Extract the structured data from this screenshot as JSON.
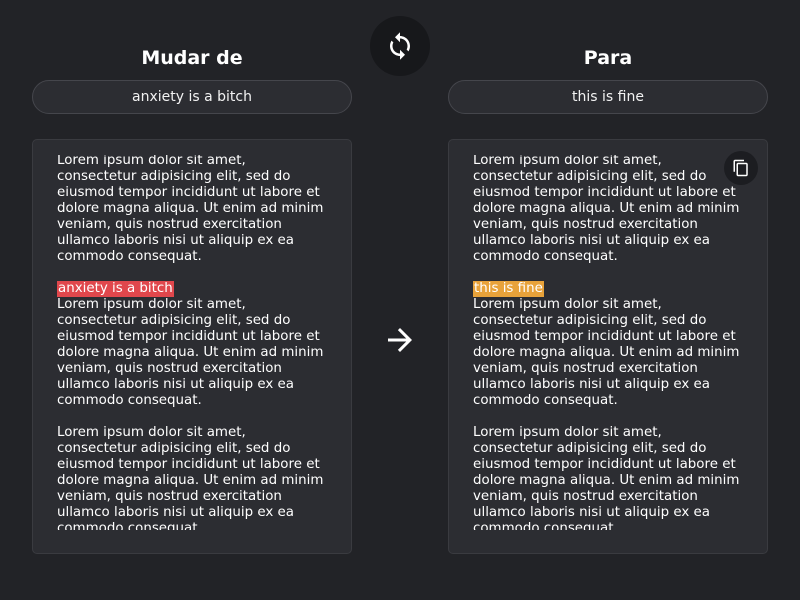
{
  "swap": {
    "icon": "swap-arrows-icon"
  },
  "source": {
    "title": "Mudar de",
    "value": "anxiety is a bitch",
    "paragraphs": [
      "Lorem ipsum dolor sit amet, consectetur adipisicing elit, sed do eiusmod tempor incididunt ut labore et dolore magna aliqua. Ut enim ad minim veniam, quis nostrud exercitation ullamco laboris nisi ut aliquip ex ea commodo consequat.",
      "Lorem ipsum dolor sit amet, consectetur adipisicing elit, sed do eiusmod tempor incididunt ut labore et dolore magna aliqua. Ut enim ad minim veniam, quis nostrud exercitation ullamco laboris nisi ut aliquip ex ea commodo consequat.",
      "Lorem ipsum dolor sit amet, consectetur adipisicing elit, sed do eiusmod tempor incididunt ut labore et dolore magna aliqua. Ut enim ad minim veniam, quis nostrud exercitation ullamco laboris nisi ut aliquip ex ea commodo consequat."
    ],
    "highlight": "anxiety is a bitch",
    "highlight_color": "#e0474c"
  },
  "target": {
    "title": "Para",
    "value": "this is fine",
    "paragraphs": [
      "Lorem ipsum dolor sit amet, consectetur adipisicing elit, sed do eiusmod tempor incididunt ut labore et dolore magna aliqua. Ut enim ad minim veniam, quis nostrud exercitation ullamco laboris nisi ut aliquip ex ea commodo consequat.",
      "Lorem ipsum dolor sit amet, consectetur adipisicing elit, sed do eiusmod tempor incididunt ut labore et dolore magna aliqua. Ut enim ad minim veniam, quis nostrud exercitation ullamco laboris nisi ut aliquip ex ea commodo consequat.",
      "Lorem ipsum dolor sit amet, consectetur adipisicing elit, sed do eiusmod tempor incididunt ut labore et dolore magna aliqua. Ut enim ad minim veniam, quis nostrud exercitation ullamco laboris nisi ut aliquip ex ea commodo consequat."
    ],
    "highlight": "this is fine",
    "highlight_color": "#e8a23a",
    "copy_icon": "copy-icon"
  },
  "arrow": {
    "icon": "arrow-right-icon"
  },
  "colors": {
    "background": "#222327",
    "panel": "#2c2d32",
    "panel_border": "#3a3b40",
    "swap_button": "#17181b"
  }
}
